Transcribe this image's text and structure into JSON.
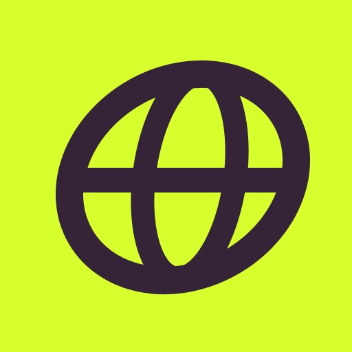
{
  "app_icon": {
    "icon": "globe-icon",
    "background_color": "#D7FF2E",
    "foreground_color": "#352337"
  }
}
